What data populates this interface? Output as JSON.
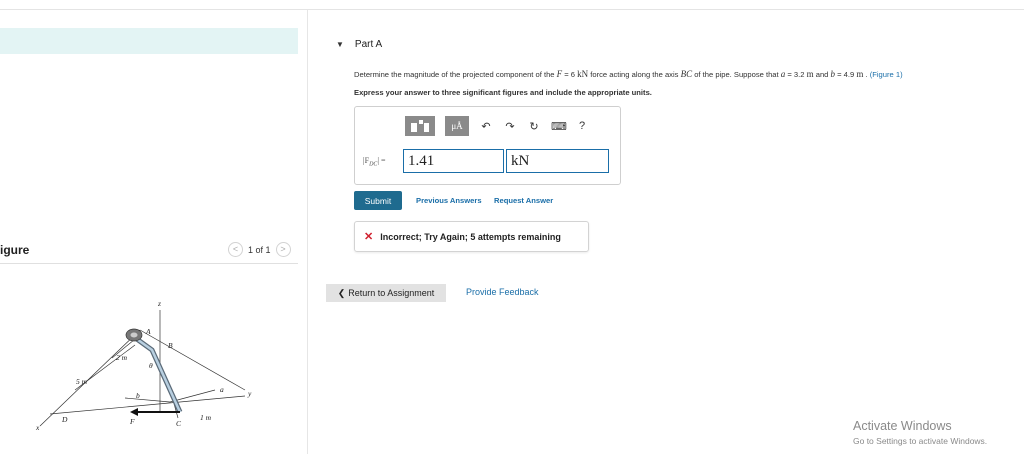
{
  "figure_panel": {
    "title": "igure",
    "pager_text": "1 of 1",
    "prev_symbol": "<",
    "next_symbol": ">",
    "diagram_labels": {
      "z": "z",
      "A": "A",
      "B": "B",
      "theta": "θ",
      "two_m": "2 m",
      "five_m": "5 m",
      "b": "b",
      "a": "a",
      "y": "y",
      "D": "D",
      "F": "F",
      "C": "C",
      "one_m": "1 m",
      "x": "x"
    }
  },
  "part": {
    "arrow": "▼",
    "title": "Part A",
    "question_pre": "Determine the magnitude of the projected component of the ",
    "F_sym": "F",
    "eq1": " = 6 ",
    "unit_kN": "kN",
    "q_mid": " force acting along the axis ",
    "BC": "BC",
    "q_mid2": " of the pipe. Suppose that ",
    "a_sym": "a",
    "eq2": " = 3.2 ",
    "unit_m": "m",
    "and_txt": " and ",
    "b_sym": "b",
    "eq3": " = 4.9 ",
    "unit_m2": "m",
    "q_end": " . ",
    "fig_link": "(Figure 1)",
    "instruction": "Express your answer to three significant figures and include the appropriate units."
  },
  "answer": {
    "label": "|F",
    "label_sub": "DC",
    "label_end": "| =",
    "value": "1.41",
    "unit": "kN",
    "toolbar": {
      "mu": "μÅ",
      "undo": "↶",
      "redo": "↷",
      "reset": "↻",
      "keyboard": "⌨",
      "help": "?"
    }
  },
  "actions": {
    "submit": "Submit",
    "previous_answers": "Previous Answers",
    "request_answer": "Request Answer"
  },
  "feedback": {
    "icon": "✕",
    "text": "Incorrect; Try Again; 5 attempts remaining"
  },
  "footer": {
    "return_arrow": "❮",
    "return": "Return to Assignment",
    "provide_feedback": "Provide Feedback"
  },
  "watermark": {
    "line1": "Activate Windows",
    "line2": "Go to Settings to activate Windows."
  }
}
